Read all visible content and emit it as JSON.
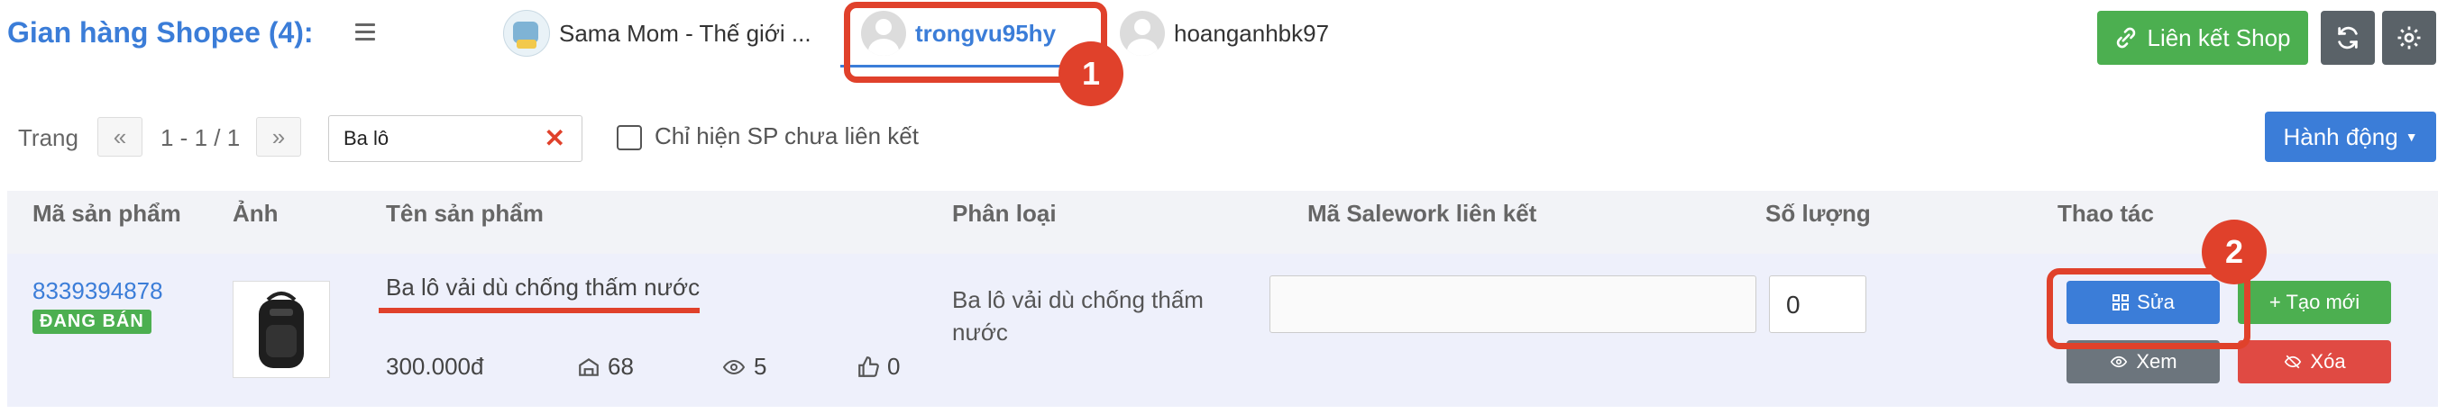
{
  "header": {
    "title": "Gian hàng Shopee (4):",
    "shop_tabs": [
      {
        "label": "Sama Mom - Thế giới ..."
      },
      {
        "label": "trongvu95hy"
      },
      {
        "label": "hoanganhbk97"
      }
    ],
    "link_shop_label": "Liên kết Shop"
  },
  "toolbar": {
    "page_label": "Trang",
    "page_range": "1 - 1 / 1",
    "prev_icon": "«",
    "next_icon": "»",
    "search_value": "Ba lô",
    "clear_icon": "✕",
    "unlinked_only_label": "Chỉ hiện SP chưa liên kết",
    "action_label": "Hành động"
  },
  "table": {
    "columns": [
      "Mã sản phẩm",
      "Ảnh",
      "Tên sản phẩm",
      "Phân loại",
      "Mã Salework liên kết",
      "Số lượng",
      "Thao tác"
    ],
    "rows": [
      {
        "product_id": "8339394878",
        "status": "ĐANG BÁN",
        "name": "Ba lô vải dù chống thấm nước",
        "price": "300.000đ",
        "stock": "68",
        "views": "5",
        "likes": "0",
        "variant_line1": "Ba lô vải dù chống thấm",
        "variant_line2": "nước",
        "salework_code": "",
        "quantity": "0",
        "actions": {
          "edit": "Sửa",
          "create": "+ Tạo mới",
          "view": "Xem",
          "delete": "Xóa"
        }
      }
    ]
  },
  "annotations": {
    "badge1": "1",
    "badge2": "2"
  },
  "colors": {
    "accent": "#3b7dd8",
    "green": "#4caf50",
    "annotation_red": "#e0412b",
    "grey": "#6c757d",
    "delete_red": "#e04a43"
  }
}
